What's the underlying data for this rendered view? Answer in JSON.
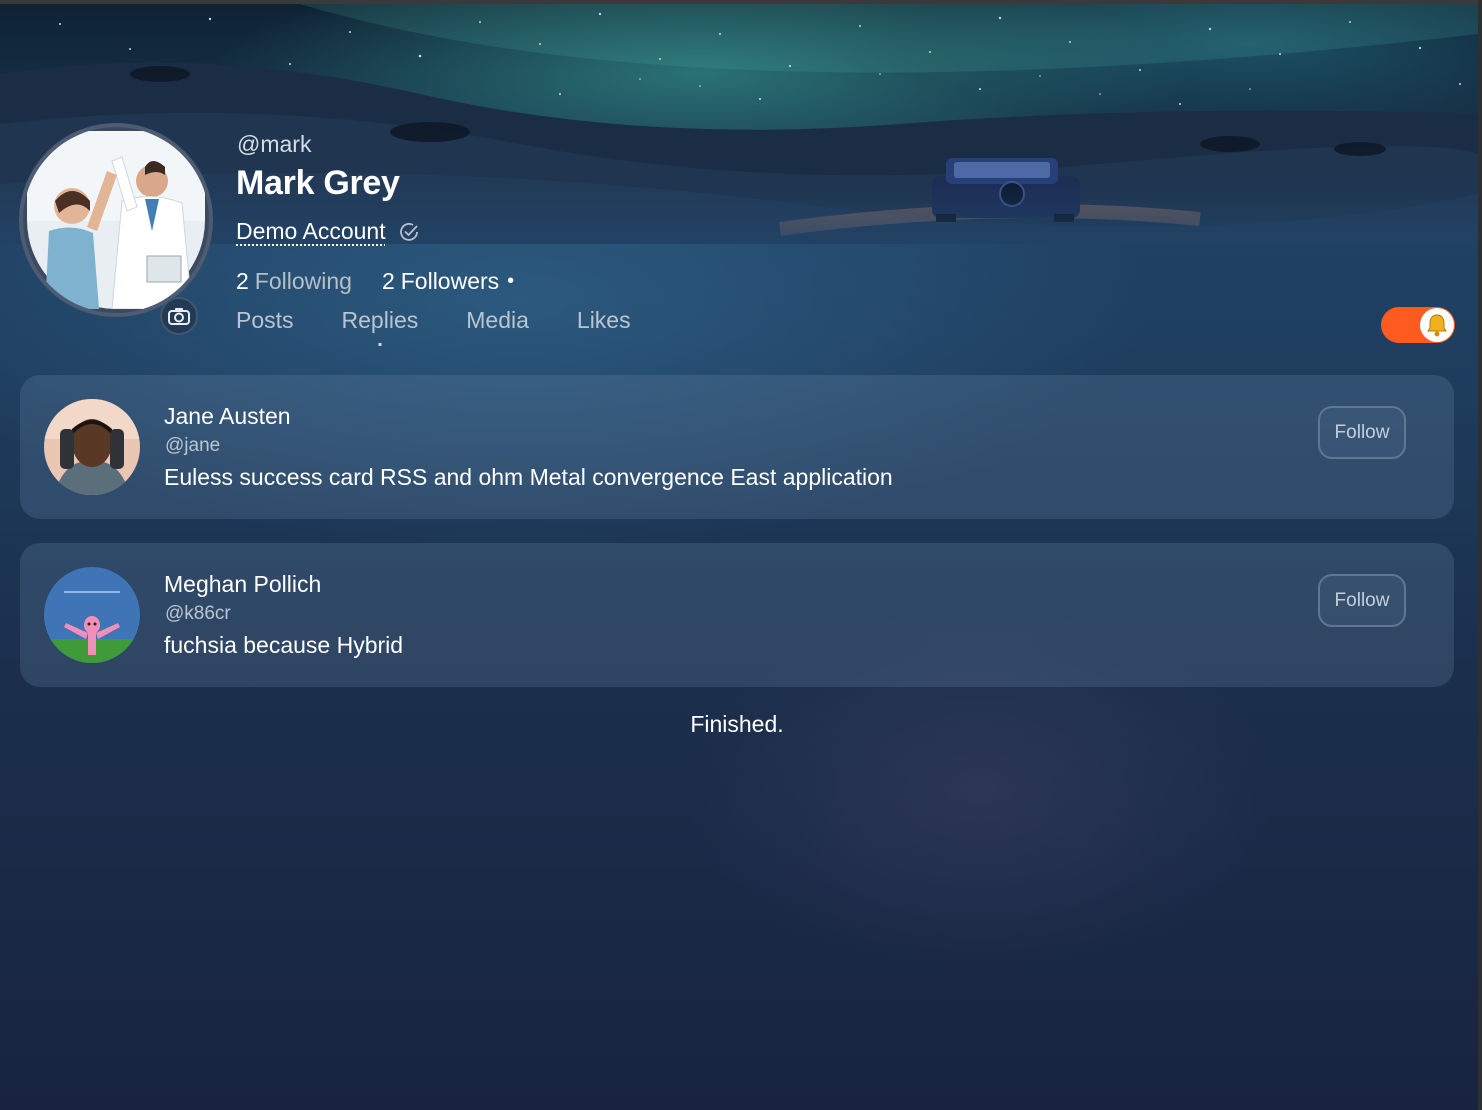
{
  "profile": {
    "handle": "@mark",
    "name": "Mark Grey",
    "account_label": "Demo Account",
    "verified_icon": "check-circle-icon",
    "following_count": "2",
    "following_label": "Following",
    "followers_count": "2",
    "followers_label": "Followers",
    "followers_dot": "•"
  },
  "tabs": [
    {
      "label": "Posts",
      "active": false
    },
    {
      "label": "Replies",
      "active": true
    },
    {
      "label": "Media",
      "active": false
    },
    {
      "label": "Likes",
      "active": false
    }
  ],
  "notification_toggle": {
    "on": true,
    "icon": "bell-icon",
    "color": "#ff5a1f"
  },
  "list": [
    {
      "name": "Jane Austen",
      "handle": "@jane",
      "text": "Euless success card RSS and ohm Metal convergence East application",
      "button": "Follow"
    },
    {
      "name": "Meghan Pollich",
      "handle": "@k86cr",
      "text": "fuchsia because Hybrid",
      "button": "Follow"
    }
  ],
  "footer": {
    "status": "Finished."
  }
}
